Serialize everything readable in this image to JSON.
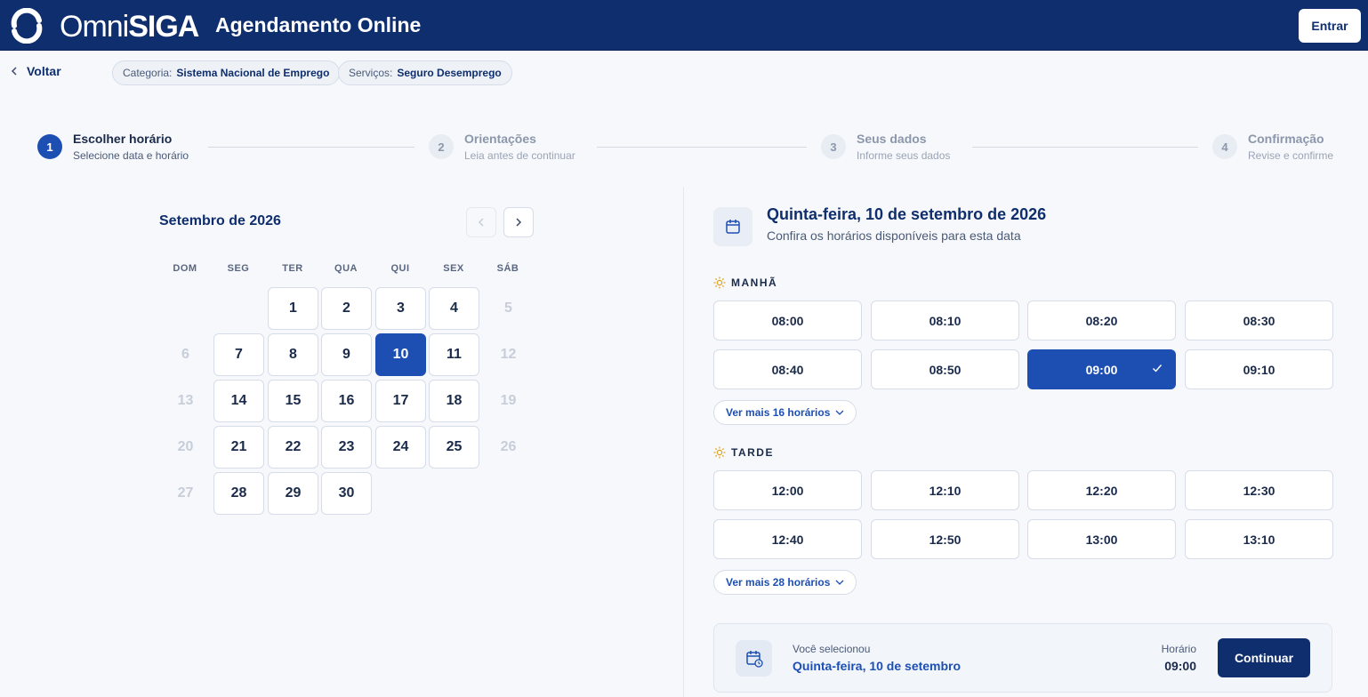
{
  "header": {
    "logo_light": "Omni",
    "logo_bold": "SIGA",
    "app_title": "Agendamento Online",
    "login_label": "Entrar"
  },
  "subbar": {
    "back_label": "Voltar",
    "chips": [
      {
        "key": "Categoria:",
        "value": "Sistema Nacional de Emprego"
      },
      {
        "key": "Serviços:",
        "value": "Seguro Desemprego"
      }
    ]
  },
  "stepper": [
    {
      "num": "1",
      "title": "Escolher horário",
      "subtitle": "Selecione data e horário",
      "active": true
    },
    {
      "num": "2",
      "title": "Orientações",
      "subtitle": "Leia antes de continuar",
      "active": false
    },
    {
      "num": "3",
      "title": "Seus dados",
      "subtitle": "Informe seus dados",
      "active": false
    },
    {
      "num": "4",
      "title": "Confirmação",
      "subtitle": "Revise e confirme",
      "active": false
    }
  ],
  "calendar": {
    "month_title": "Setembro de 2026",
    "weekdays": [
      "DOM",
      "SEG",
      "TER",
      "QUA",
      "QUI",
      "SEX",
      "SÁB"
    ],
    "weeks": [
      [
        null,
        null,
        "1",
        "2",
        "3",
        "4",
        "5"
      ],
      [
        "6",
        "7",
        "8",
        "9",
        "10",
        "11",
        "12"
      ],
      [
        "13",
        "14",
        "15",
        "16",
        "17",
        "18",
        "19"
      ],
      [
        "20",
        "21",
        "22",
        "23",
        "24",
        "25",
        "26"
      ],
      [
        "27",
        "28",
        "29",
        "30",
        null,
        null,
        null
      ]
    ],
    "selected_day": "10"
  },
  "schedule": {
    "date_title": "Quinta-feira, 10 de setembro de 2026",
    "date_subtitle": "Confira os horários disponíveis para esta data",
    "morning": {
      "label": "MANHÃ",
      "slots": [
        "08:00",
        "08:10",
        "08:20",
        "08:30",
        "08:40",
        "08:50",
        "09:00",
        "09:10"
      ],
      "more_label": "Ver mais 16 horários"
    },
    "afternoon": {
      "label": "TARDE",
      "slots": [
        "12:00",
        "12:10",
        "12:20",
        "12:30",
        "12:40",
        "12:50",
        "13:00",
        "13:10"
      ],
      "more_label": "Ver mais 28 horários"
    },
    "selected_slot": "09:00"
  },
  "summary": {
    "label": "Você selecionou",
    "value": "Quinta-feira, 10 de setembro",
    "time_label": "Horário",
    "time_value": "09:00",
    "continue_label": "Continuar"
  },
  "colors": {
    "header_bg": "#0f2e6e",
    "accent": "#1d4fb3",
    "page_bg": "#f6f8fb"
  }
}
